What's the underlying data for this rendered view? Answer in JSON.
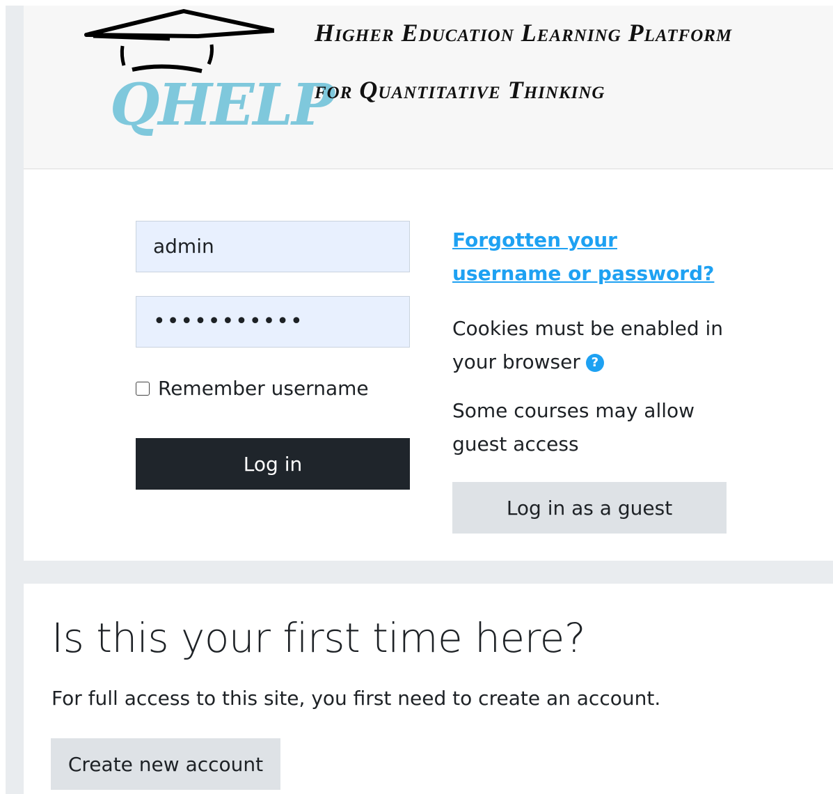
{
  "header": {
    "logo_text": "QHELP",
    "title_line1": "Higher Education Learning Platform",
    "title_line2": "for Quantitative Thinking"
  },
  "login": {
    "username_value": "admin",
    "password_value": "•••••••••••",
    "remember_label": "Remember username",
    "remember_checked": false,
    "login_button": "Log in",
    "forgot_link": "Forgotten your username or password?",
    "cookies_text": "Cookies must be enabled in your browser",
    "guest_note": "Some courses may allow guest access",
    "guest_button": "Log in as a guest"
  },
  "signup": {
    "title": "Is this your first time here?",
    "text": "For full access to this site, you first need to create an account.",
    "create_button": "Create new account"
  },
  "colors": {
    "accent_link": "#1ea1f2",
    "primary_button": "#1f252b",
    "secondary_button": "#dee2e6",
    "input_fill": "#e8f0fe",
    "logo_color": "#7fc8dc",
    "page_background": "#e9ecef"
  }
}
